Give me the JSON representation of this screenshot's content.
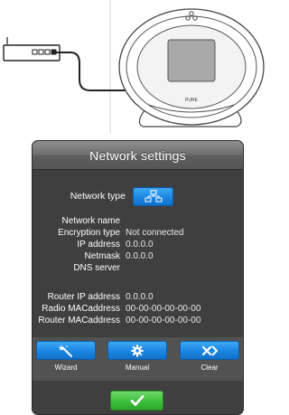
{
  "illustration": {
    "brand": "PURE"
  },
  "dialog": {
    "title": "Network settings",
    "network_type_label": "Network type",
    "network_type_icon": "network-icon",
    "fields": [
      {
        "label": "Network name",
        "value": ""
      },
      {
        "label": "Encryption type",
        "value": "Not connected"
      },
      {
        "label": "IP address",
        "value": "0.0.0.0"
      },
      {
        "label": "Netmask",
        "value": "0.0.0.0"
      },
      {
        "label": "DNS server",
        "value": ""
      }
    ],
    "router_fields": [
      {
        "label": "Router IP address",
        "value": "0.0.0.0"
      },
      {
        "label": "Radio MACaddress",
        "value": "00-00-00-00-00-00"
      },
      {
        "label": "Router MACaddress",
        "value": "00-00-00-00-00-00"
      }
    ],
    "tools": [
      {
        "label": "Wizard",
        "icon": "magic-wand-icon"
      },
      {
        "label": "Manual",
        "icon": "gear-icon"
      },
      {
        "label": "Clear",
        "icon": "clear-icon"
      }
    ],
    "ok_icon": "checkmark-icon"
  },
  "colors": {
    "panel_bg": "#3f3f3f",
    "button_blue": "#1a86e2",
    "button_green": "#3cbf3a"
  }
}
